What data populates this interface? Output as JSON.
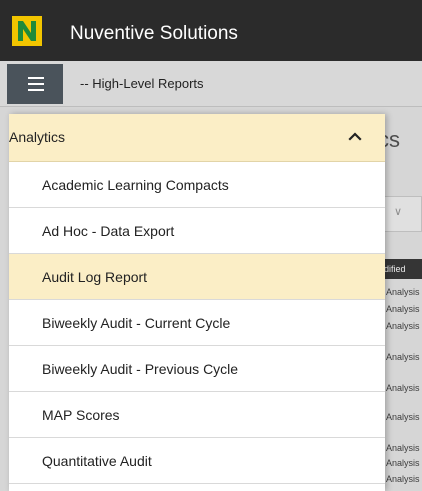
{
  "app": {
    "title": "Nuventive Solutions"
  },
  "subbar": {
    "breadcrumb": "-- High-Level Reports"
  },
  "background": {
    "heading_fragment": "cs",
    "column_header": "dified",
    "row_texts": [
      "Analysis",
      "Analysis",
      "Analysis",
      "Analysis",
      "Analysis",
      "Analysis",
      "Analysis",
      "Analysis",
      "Analysis"
    ]
  },
  "drawer": {
    "section_label": "Analytics",
    "items": [
      {
        "label": "Academic Learning Compacts",
        "selected": false
      },
      {
        "label": "Ad Hoc - Data Export",
        "selected": false
      },
      {
        "label": "Audit Log Report",
        "selected": true
      },
      {
        "label": "Biweekly Audit - Current Cycle",
        "selected": false
      },
      {
        "label": "Biweekly Audit - Previous Cycle",
        "selected": false
      },
      {
        "label": "MAP Scores",
        "selected": false
      },
      {
        "label": "Quantitative Audit",
        "selected": false
      }
    ]
  },
  "colors": {
    "topbar": "#2b2b2b",
    "menu_button": "#4a535b",
    "highlight": "#fbeec6",
    "logo_yellow": "#f2c500",
    "logo_green": "#1f8a3a"
  },
  "icons": {
    "logo": "nuventive-logo",
    "menu": "hamburger-icon",
    "collapse": "chevron-up-icon"
  }
}
